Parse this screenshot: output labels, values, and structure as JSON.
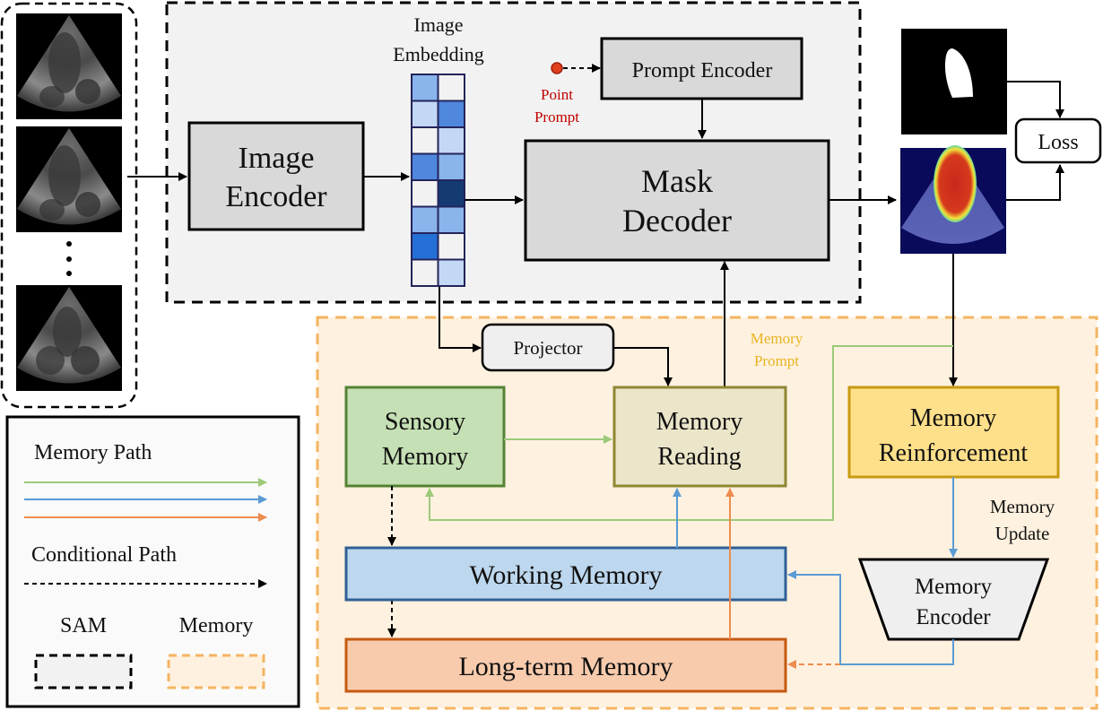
{
  "input_frames": {
    "label": "Echocardiogram input frames",
    "count_shown": 3,
    "ellipsis": "⋮"
  },
  "sam_module": {
    "image_encoder": [
      "Image",
      "Encoder"
    ],
    "image_embedding_title": [
      "Image",
      "Embedding"
    ],
    "image_embedding_cells": [
      [
        "#8ab4ec",
        "#f2f2f2"
      ],
      [
        "#c3d8f5",
        "#4f88dd"
      ],
      [
        "#f2f2f2",
        "#c3d8f5"
      ],
      [
        "#4f88dd",
        "#8ab4ec"
      ],
      [
        "#f2f2f2",
        "#143a73"
      ],
      [
        "#8ab4ec",
        "#8ab4ec"
      ],
      [
        "#2470d6",
        "#f2f2f2"
      ],
      [
        "#f2f2f2",
        "#c3d8f5"
      ]
    ],
    "prompt_encoder": "Prompt Encoder",
    "point_prompt": [
      "Point",
      "Prompt"
    ],
    "mask_decoder": [
      "Mask",
      "Decoder"
    ]
  },
  "outputs": {
    "ground_truth_label": "Ground truth mask",
    "prediction_label": "Predicted heatmap",
    "loss": "Loss"
  },
  "memory_module": {
    "projector": "Projector",
    "memory_prompt": [
      "Memory",
      "Prompt"
    ],
    "sensory_memory": [
      "Sensory",
      "Memory"
    ],
    "memory_reading": [
      "Memory",
      "Reading"
    ],
    "memory_reinforcement": [
      "Memory",
      "Reinforcement"
    ],
    "memory_update": [
      "Memory",
      "Update"
    ],
    "memory_encoder": [
      "Memory",
      "Encoder"
    ],
    "working_memory": "Working Memory",
    "long_term_memory": "Long-term Memory"
  },
  "legend": {
    "memory_path": "Memory Path",
    "conditional_path": "Conditional Path",
    "sam": "SAM",
    "memory": "Memory"
  },
  "colors": {
    "green_path": "#9cc97a",
    "blue_path": "#5b9bd5",
    "orange_path": "#ed8c4f",
    "sam_bg": "#f2f2f2",
    "memory_bg": "#fff1df",
    "memory_border": "#f4b461",
    "point_prompt_text": "#c00000",
    "memory_prompt_text": "#e6b422"
  }
}
